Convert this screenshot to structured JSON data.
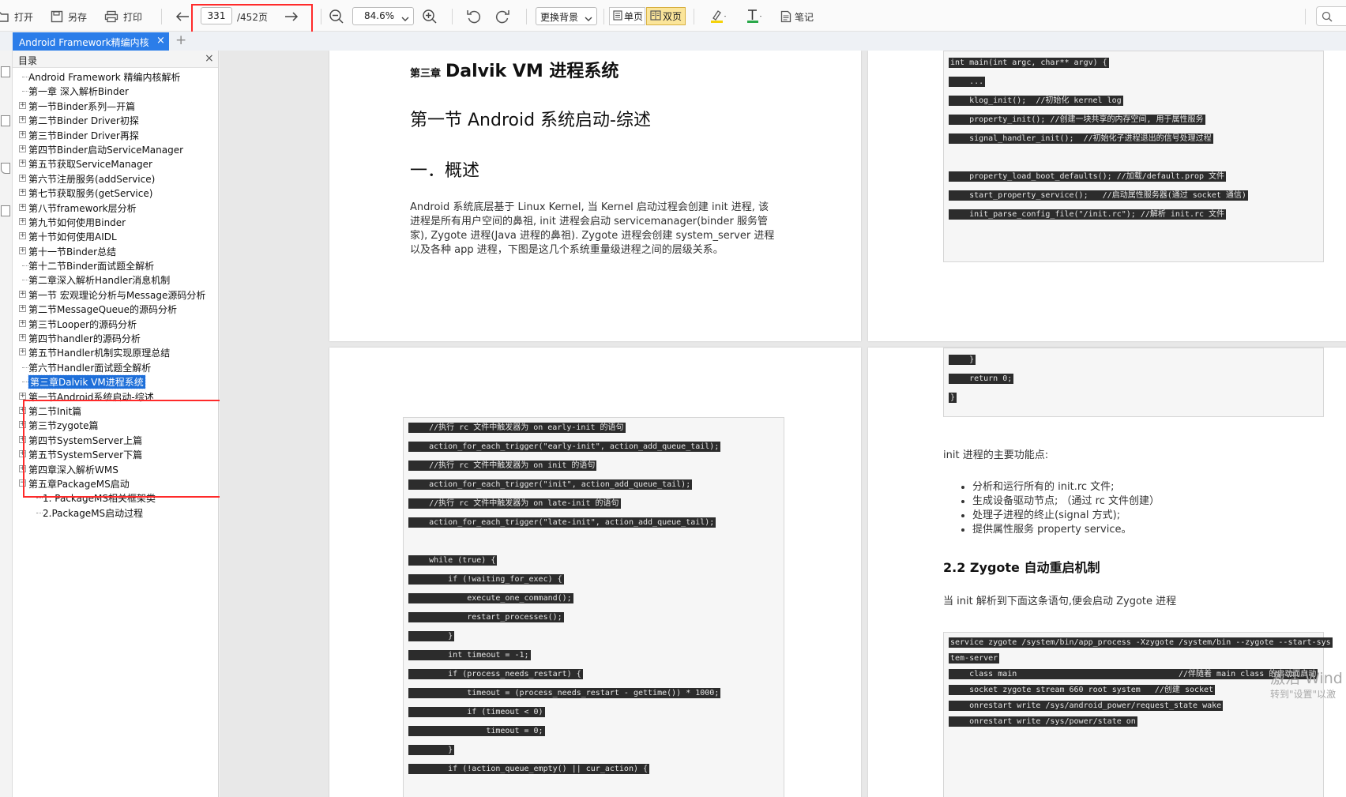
{
  "toolbar": {
    "open_label": "打开",
    "saveas_label": "另存",
    "print_label": "打印",
    "page_current": "331",
    "page_total": "/452页",
    "zoom_value": "84.6%",
    "background_label": "更换背景",
    "single_page_label": "单页",
    "double_page_label": "双页",
    "notes_label": "笔记"
  },
  "tab": {
    "title": "Android Framework精编内核",
    "close": "×",
    "add": "+"
  },
  "outline": {
    "title": "目录",
    "close": "×",
    "items": [
      {
        "label": "Android Framework 精编内核解析",
        "toggle": "",
        "level": 0
      },
      {
        "label": "第一章 深入解析Binder",
        "toggle": "",
        "level": 0
      },
      {
        "label": "第一节Binder系列—开篇",
        "toggle": "+",
        "level": 0
      },
      {
        "label": "第二节Binder Driver初探",
        "toggle": "+",
        "level": 0
      },
      {
        "label": "第三节Binder Driver再探",
        "toggle": "+",
        "level": 0
      },
      {
        "label": "第四节Binder启动ServiceManager",
        "toggle": "+",
        "level": 0
      },
      {
        "label": "第五节获取ServiceManager",
        "toggle": "+",
        "level": 0
      },
      {
        "label": "第六节注册服务(addService)",
        "toggle": "+",
        "level": 0
      },
      {
        "label": "第七节获取服务(getService)",
        "toggle": "+",
        "level": 0
      },
      {
        "label": "第八节framework层分析",
        "toggle": "+",
        "level": 0
      },
      {
        "label": "第九节如何使用Binder",
        "toggle": "+",
        "level": 0
      },
      {
        "label": "第十节如何使用AIDL",
        "toggle": "+",
        "level": 0
      },
      {
        "label": "第十一节Binder总结",
        "toggle": "+",
        "level": 0
      },
      {
        "label": "第十二节Binder面试题全解析",
        "toggle": "",
        "level": 0
      },
      {
        "label": "第二章深入解析Handler消息机制",
        "toggle": "",
        "level": 0
      },
      {
        "label": "第一节 宏观理论分析与Message源码分析",
        "toggle": "+",
        "level": 0
      },
      {
        "label": "第二节MessageQueue的源码分析",
        "toggle": "+",
        "level": 0
      },
      {
        "label": "第三节Looper的源码分析",
        "toggle": "+",
        "level": 0
      },
      {
        "label": "第四节handler的源码分析",
        "toggle": "+",
        "level": 0
      },
      {
        "label": "第五节Handler机制实现原理总结",
        "toggle": "+",
        "level": 0
      },
      {
        "label": "第六节Handler面试题全解析",
        "toggle": "",
        "level": 0
      },
      {
        "label": "第三章Dalvik VM进程系统",
        "toggle": "",
        "level": 0,
        "selected": true
      },
      {
        "label": "第一节Android系统启动-综述",
        "toggle": "+",
        "level": 0
      },
      {
        "label": "第二节Init篇",
        "toggle": "+",
        "level": 0
      },
      {
        "label": "第三节zygote篇",
        "toggle": "+",
        "level": 0
      },
      {
        "label": "第四节SystemServer上篇",
        "toggle": "+",
        "level": 0
      },
      {
        "label": "第五节SystemServer下篇",
        "toggle": "+",
        "level": 0
      },
      {
        "label": "第四章深入解析WMS",
        "toggle": "+",
        "level": 0
      },
      {
        "label": "第五章PackageMS启动",
        "toggle": "−",
        "level": 0
      },
      {
        "label": "1. PackageMS相关框架类",
        "toggle": "",
        "level": 1
      },
      {
        "label": "2.PackageMS启动过程",
        "toggle": "",
        "level": 1
      }
    ]
  },
  "page1": {
    "chapter_prefix": "第三章",
    "chapter_title": "Dalvik VM 进程系统",
    "section_title": "第一节 Android 系统启动-综述",
    "subsection_title": "一．概述",
    "paragraph": "Android 系统底层基于 Linux Kernel, 当 Kernel 启动过程会创建 init 进程, 该进程是所有用户空间的鼻祖, init 进程会启动 servicemanager(binder 服务管家), Zygote 进程(Java 进程的鼻祖). Zygote 进程会创建 system_server 进程以及各种 app 进程，下图是这几个系统重量级进程之间的层级关系。"
  },
  "page2": {
    "code": [
      "int main(int argc, char** argv) {",
      "    ...",
      "    klog_init();  //初始化 kernel log",
      "    property_init(); //创建一块共享的内存空间, 用于属性服务",
      "    signal_handler_init();  //初始化子进程退出的信号处理过程",
      "",
      "    property_load_boot_defaults(); //加载/default.prop 文件",
      "    start_property_service();   //启动属性服务器(通过 socket 通信)",
      "    init_parse_config_file(\"/init.rc\"); //解析 init.rc 文件"
    ]
  },
  "page3": {
    "code": [
      "    //执行 rc 文件中触发器为 on early-init 的语句",
      "    action_for_each_trigger(\"early-init\", action_add_queue_tail);",
      "    //执行 rc 文件中触发器为 on init 的语句",
      "    action_for_each_trigger(\"init\", action_add_queue_tail);",
      "    //执行 rc 文件中触发器为 on late-init 的语句",
      "    action_for_each_trigger(\"late-init\", action_add_queue_tail);",
      "",
      "    while (true) {",
      "        if (!waiting_for_exec) {",
      "            execute_one_command();",
      "            restart_processes();",
      "        }",
      "        int timeout = -1;",
      "        if (process_needs_restart) {",
      "            timeout = (process_needs_restart - gettime()) * 1000;",
      "            if (timeout < 0)",
      "                timeout = 0;",
      "        }",
      "        if (!action_queue_empty() || cur_action) {"
    ]
  },
  "page4": {
    "code_top": [
      "    }",
      "    return 0;",
      "}"
    ],
    "intro": "init 进程的主要功能点:",
    "bullets": [
      "分析和运行所有的 init.rc 文件;",
      "生成设备驱动节点; （通过 rc 文件创建）",
      "处理子进程的终止(signal 方式);",
      "提供属性服务 property service。"
    ],
    "heading": "2.2 Zygote 自动重启机制",
    "para": "当 init 解析到下面这条语句,便会启动 Zygote 进程",
    "code_bottom": [
      "service zygote /system/bin/app_process -Xzygote /system/bin --zygote --start-sys",
      "tem-server",
      "    class main                                  //伴随着 main class 的启动而启动",
      "    socket zygote stream 660 root system   //创建 socket",
      "    onrestart write /sys/android_power/request_state wake",
      "    onrestart write /sys/power/state on"
    ]
  },
  "watermark": {
    "line1": "激活 Wind",
    "line2": "转到\"设置\"以激"
  }
}
